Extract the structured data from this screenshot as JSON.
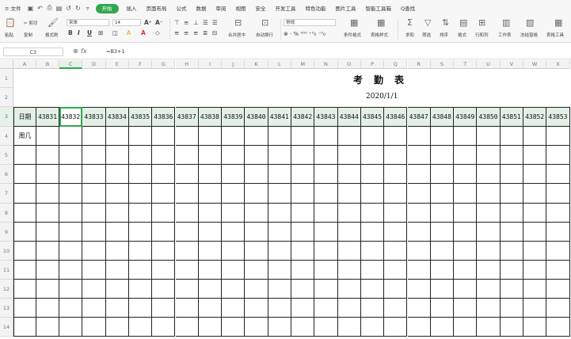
{
  "menubar": {
    "file": "≡ 文件",
    "tabs": [
      "开始",
      "插入",
      "页面布局",
      "公式",
      "数据",
      "审阅",
      "视图",
      "安全",
      "开发工具",
      "特色功能",
      "图片工具",
      "智能工具箱"
    ],
    "active_tab": "开始",
    "search": "Q查找"
  },
  "ribbon": {
    "paste": "粘贴",
    "cut": "✂ 剪切",
    "copy": "复制",
    "format_painter": "格式刷",
    "font_name": "宋体",
    "font_size": "14",
    "merge": "合并居中",
    "wrap": "自动换行",
    "number_format": "常规",
    "conditional": "条件格式",
    "table_style": "表格样式",
    "sum": "求和",
    "filter": "筛选",
    "sort": "排序",
    "format": "格式",
    "rows_cols": "行和列",
    "worksheet": "工作表",
    "freeze": "冻结窗格",
    "table_tools": "表格工具"
  },
  "formula_bar": {
    "cell_ref": "C3",
    "fx": "fx",
    "formula": "=B3+1"
  },
  "sheet": {
    "columns": [
      "A",
      "B",
      "C",
      "D",
      "E",
      "F",
      "G",
      "H",
      "I",
      "J",
      "K",
      "L",
      "M",
      "N",
      "O",
      "P",
      "Q",
      "R",
      "S",
      "T",
      "U",
      "V",
      "W",
      "X"
    ],
    "selected_column": "C",
    "rows": [
      "1",
      "2",
      "3",
      "4",
      "5",
      "6",
      "7",
      "8",
      "9",
      "10",
      "11",
      "12",
      "13",
      "14"
    ],
    "selected_row": "3",
    "title": "考勤表",
    "date": "2020/1/1",
    "row3_label": "日期",
    "row4_label": "周几",
    "row3_values": [
      "43831",
      "43832",
      "43833",
      "43834",
      "43835",
      "43836",
      "43837",
      "43838",
      "43839",
      "43840",
      "43841",
      "43842",
      "43843",
      "43844",
      "43845",
      "43846",
      "43847",
      "43848",
      "43849",
      "43850",
      "43851",
      "43852",
      "43853"
    ]
  }
}
